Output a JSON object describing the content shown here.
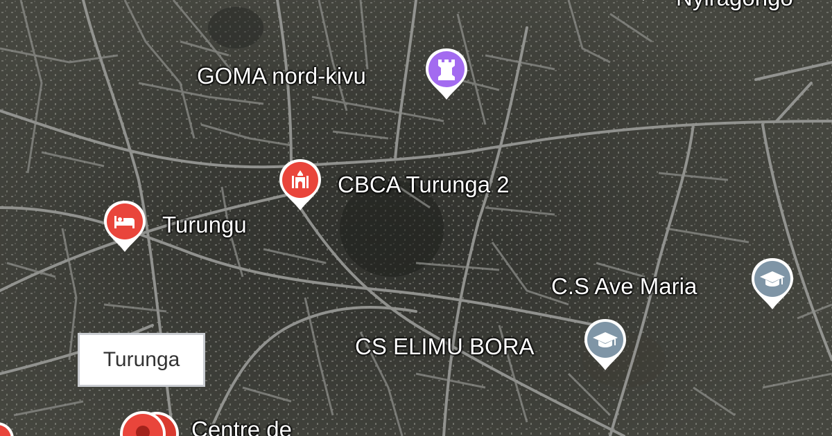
{
  "places": {
    "goma": {
      "label": "GOMA nord-kivu",
      "category": "landmark",
      "icon": "rook-icon",
      "color": "#a36bf0"
    },
    "cbca": {
      "label": "CBCA Turunga 2",
      "category": "church",
      "icon": "church-icon",
      "color": "#e9453b"
    },
    "turungu": {
      "label": "Turungu",
      "category": "lodging",
      "icon": "bed-icon",
      "color": "#e9453b"
    },
    "ave_maria": {
      "label": "C.S Ave Maria",
      "category": "school",
      "icon": "graduation-cap-icon",
      "color": "#7f95a6"
    },
    "elimu": {
      "label": "CS ELIMU BORA",
      "category": "school",
      "icon": "graduation-cap-icon",
      "color": "#7f95a6"
    },
    "centre": {
      "label": "Centre de",
      "category": "place",
      "icon": "map-pin-icon",
      "color": "#e9453b"
    },
    "top_right": {
      "label": "Nyiragongo",
      "icon": "pin-icon"
    }
  },
  "area_label": "Turunga"
}
